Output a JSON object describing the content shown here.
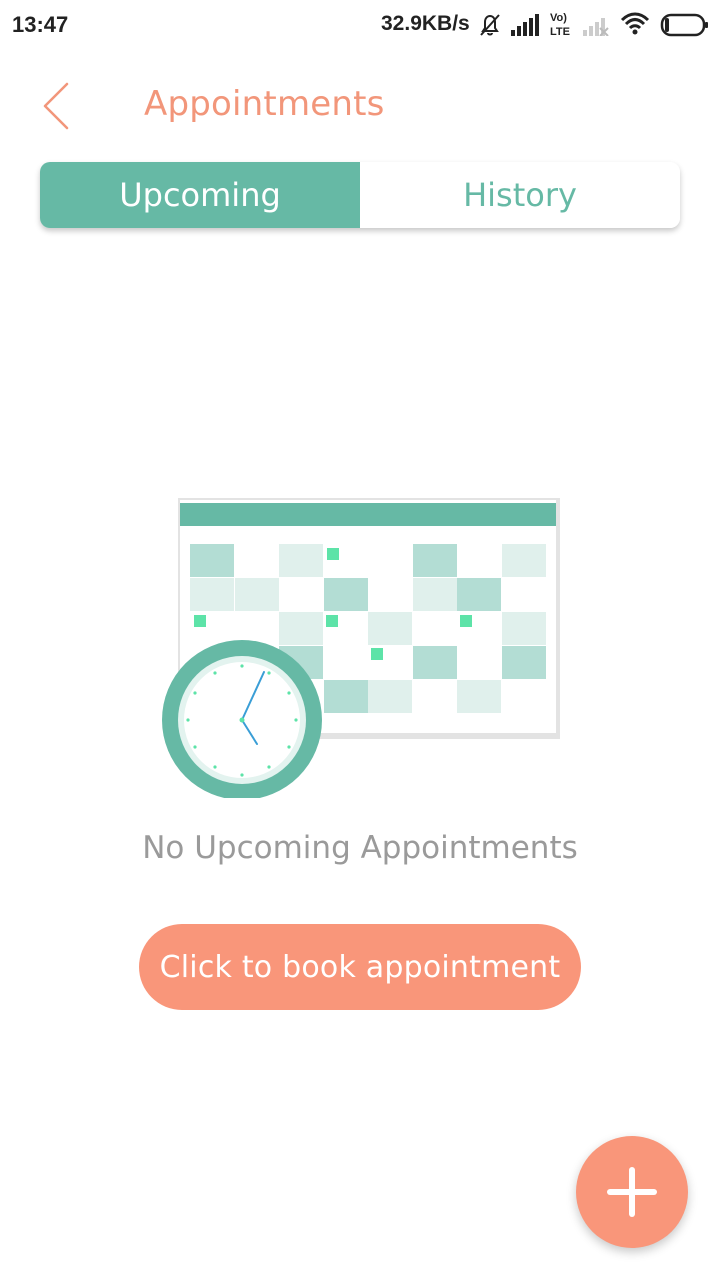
{
  "status_bar": {
    "time": "13:47",
    "network_speed": "32.9KB/s",
    "icons": [
      "mute-bell-icon",
      "signal-icon",
      "volte-icon",
      "signal-weak-icon",
      "wifi-icon",
      "battery-icon"
    ],
    "volte_top": "Vo)",
    "volte_bottom": "LTE"
  },
  "header": {
    "back_icon": "chevron-left-icon",
    "title": "Appointments"
  },
  "tabs": [
    {
      "label": "Upcoming",
      "selected": true
    },
    {
      "label": "History",
      "selected": false
    }
  ],
  "empty_state": {
    "illustration": "calendar-clock-illustration",
    "message": "No Upcoming Appointments"
  },
  "book_button": {
    "label": "Click to book appointment"
  },
  "fab": {
    "icon": "plus-icon"
  },
  "colors": {
    "accent_orange": "#f9967a",
    "title_orange": "#f2967a",
    "teal": "#66b9a5",
    "muted_text": "#9a9a9a"
  }
}
